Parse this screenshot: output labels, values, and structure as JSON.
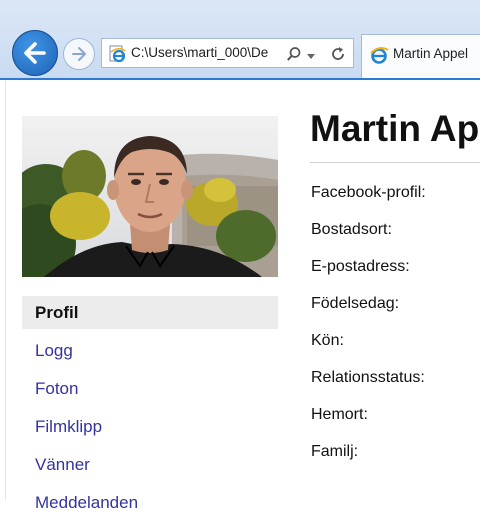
{
  "browser": {
    "address_url": "C:\\Users\\marti_000\\De",
    "tab_title": "Martin Appel"
  },
  "profile": {
    "name": "Martin Ap",
    "nav": [
      {
        "label": "Profil",
        "active": true
      },
      {
        "label": "Logg"
      },
      {
        "label": "Foton"
      },
      {
        "label": "Filmklipp"
      },
      {
        "label": "Vänner"
      },
      {
        "label": "Meddelanden"
      }
    ],
    "fields": [
      "Facebook-profil:",
      "Bostadsort:",
      "E-postadress:",
      "Födelsedag:",
      "Kön:",
      "Relationsstatus:",
      "Hemort:",
      "Familj:"
    ]
  },
  "colors": {
    "link": "#3333a0",
    "active_bg": "#ececec",
    "chrome_accent": "#2c7ad6"
  }
}
